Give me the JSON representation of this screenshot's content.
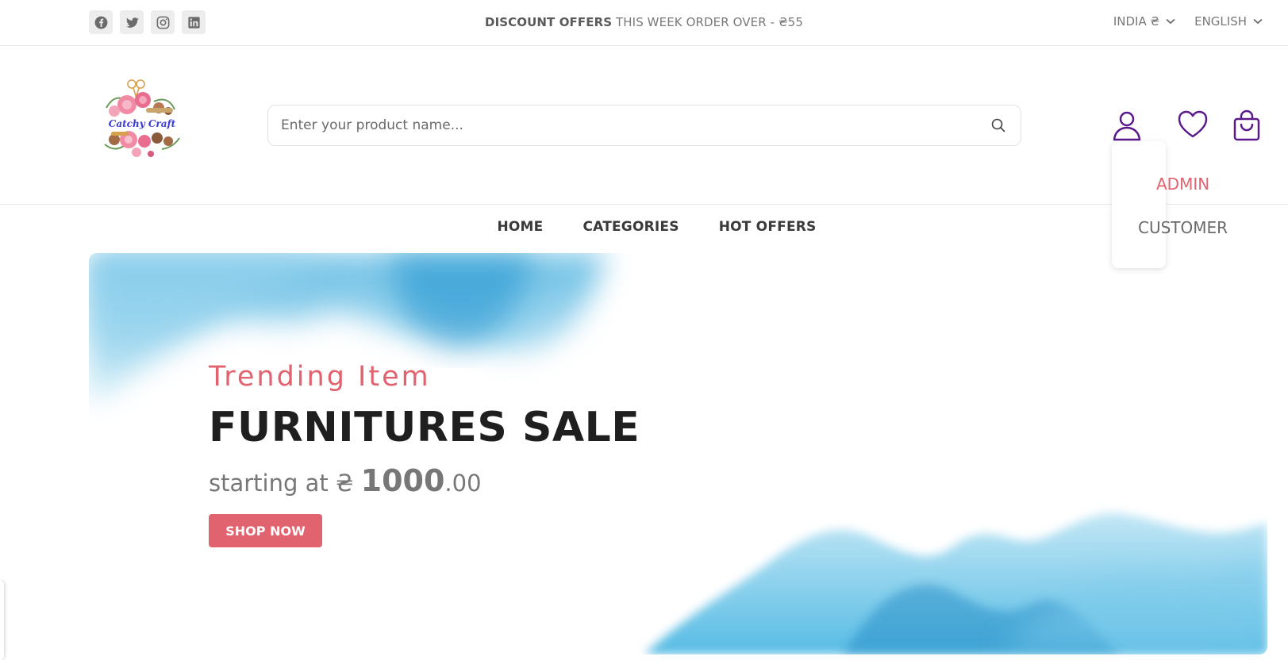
{
  "topbar": {
    "socials": [
      "facebook-icon",
      "twitter-icon",
      "instagram-icon",
      "linkedin-icon"
    ],
    "offer_bold": "DISCOUNT OFFERS",
    "offer_rest": " THIS WEEK ORDER OVER - ₴55",
    "currency": "INDIA ₴",
    "language": "ENGLISH"
  },
  "header": {
    "logo_text": "Catchy Craft",
    "search_placeholder": "Enter your product name...",
    "icons": [
      "user-icon",
      "heart-icon",
      "shopping-bag-icon"
    ]
  },
  "dropdown": {
    "items": [
      "ADMIN",
      "CUSTOMER"
    ]
  },
  "nav": {
    "items": [
      "HOME",
      "CATEGORIES",
      "HOT OFFERS"
    ]
  },
  "hero": {
    "subtitle": "Trending Item",
    "title": "FURNITURES SALE",
    "price_prefix": "starting at ₴ ",
    "price_main": "1000",
    "price_cents": ".00",
    "cta": "SHOP NOW"
  },
  "colors": {
    "accent": "#e0636f",
    "icon_purple": "#5b1a8c",
    "watercolor": "#4fb6e0"
  }
}
